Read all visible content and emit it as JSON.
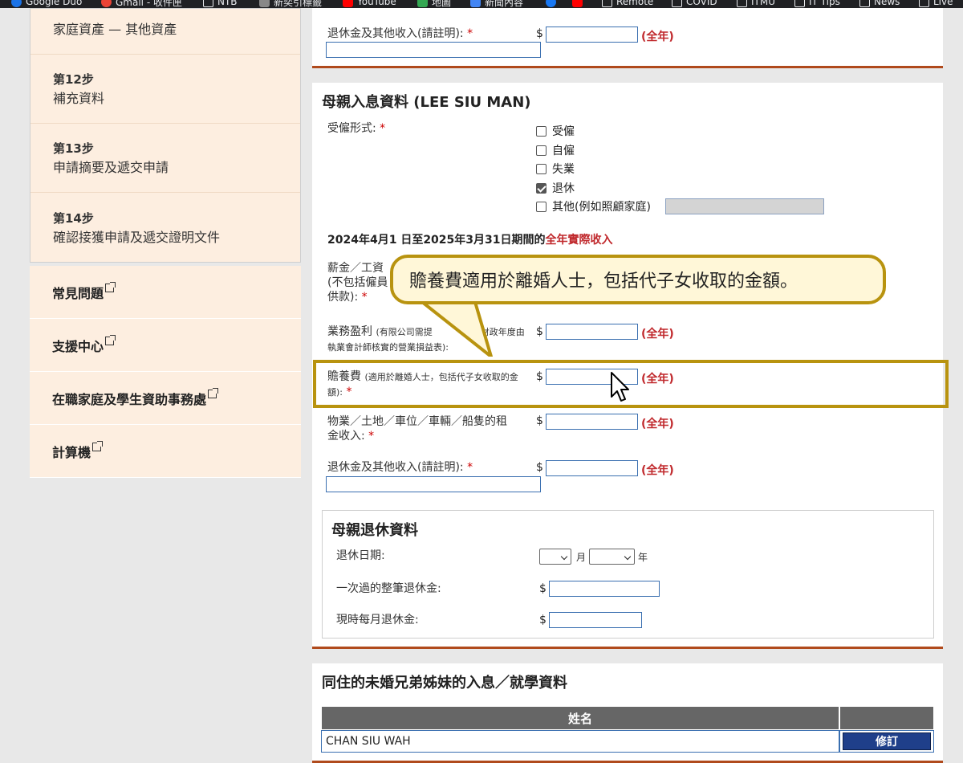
{
  "bookmarks": [
    {
      "label": "Google Duo",
      "icon": "google-duo-icon",
      "color": "#1a73e8"
    },
    {
      "label": "Gmail - 收件匣",
      "icon": "google-icon",
      "color": "#ea4335"
    },
    {
      "label": "NTB",
      "icon": "folder-icon"
    },
    {
      "label": "新奕引標籤",
      "icon": "bookmark-icon",
      "color": "#888888"
    },
    {
      "label": "YouTube",
      "icon": "youtube-icon",
      "color": "#ff0000"
    },
    {
      "label": "地圖",
      "icon": "maps-icon",
      "color": "#34a853"
    },
    {
      "label": "新聞內容",
      "icon": "news-icon",
      "color": "#4285f4"
    },
    {
      "label": "",
      "icon": "facebook-icon",
      "color": "#1877f2"
    },
    {
      "label": "",
      "icon": "youtube-icon",
      "color": "#ff0000"
    },
    {
      "label": "Remote",
      "icon": "folder-icon"
    },
    {
      "label": "COVID",
      "icon": "folder-icon"
    },
    {
      "label": "ITMU",
      "icon": "folder-icon"
    },
    {
      "label": "IT Tips",
      "icon": "folder-icon"
    },
    {
      "label": "News",
      "icon": "folder-icon"
    },
    {
      "label": "Live",
      "icon": "folder-icon"
    }
  ],
  "sidebar": {
    "steps": [
      {
        "num": "",
        "title": "家庭資產 — 其他資產"
      },
      {
        "num": "第12步",
        "title": "補充資料"
      },
      {
        "num": "第13步",
        "title": "申請摘要及遞交申請"
      },
      {
        "num": "第14步",
        "title": "確認接獲申請及遞交證明文件"
      }
    ],
    "links": [
      {
        "label": "常見問題"
      },
      {
        "label": "支援中心"
      },
      {
        "label": "在職家庭及學生資助事務處"
      },
      {
        "label": "計算機"
      }
    ]
  },
  "top_card": {
    "retirement_label": "退休金及其他收入(請註明):",
    "required": "*",
    "dollar": "$",
    "year_label": "(全年)"
  },
  "mother": {
    "title": "母親入息資料 (LEE SIU MAN)",
    "employment_label": "受僱形式:",
    "required": "*",
    "options": [
      {
        "label": "受僱",
        "checked": false
      },
      {
        "label": "自僱",
        "checked": false
      },
      {
        "label": "失業",
        "checked": false
      },
      {
        "label": "退休",
        "checked": true
      },
      {
        "label": "其他(例如照顧家庭)",
        "checked": false
      }
    ],
    "period_prefix": "2024年4月1 日至2025年3月31日期間的",
    "period_highlight": "全年實際收入",
    "salary_label_1": "薪金／工資",
    "salary_label_2": "(不包括僱員",
    "salary_label_3": "供款):",
    "business_label": "業務盈利",
    "business_note_1": "(有限公司需提",
    "business_note_2": "財政年度由",
    "business_note_3": "執業會計師核實的營業損益表):",
    "alimony_label": "贍養費",
    "alimony_note": "(適用於離婚人士，包括代子女收取的金",
    "alimony_note_2": "額):",
    "rental_label_1": "物業／土地／車位／車輛／船隻的租",
    "rental_label_2": "金收入:",
    "retirement_label": "退休金及其他收入(請註明):",
    "dollar": "$",
    "year_label": "(全年)"
  },
  "retirement": {
    "title": "母親退休資料",
    "date_label": "退休日期:",
    "month_unit": "月",
    "year_unit": "年",
    "lump_label": "一次過的整筆退休金:",
    "monthly_label": "現時每月退休金:",
    "dollar": "$"
  },
  "siblings": {
    "title": "同住的未婚兄弟姊妹的入息／就學資料",
    "col_name": "姓名",
    "rows": [
      {
        "name": "CHAN SIU WAH",
        "action": "修訂"
      }
    ]
  },
  "callout": {
    "text": "贍養費適用於離婚人士，包括代子女收取的金額。"
  },
  "colors": {
    "accent_red": "#c0282c",
    "highlight_gold": "#b8930f",
    "section_rule": "#b04a1c",
    "button_blue": "#1f3f8a"
  }
}
